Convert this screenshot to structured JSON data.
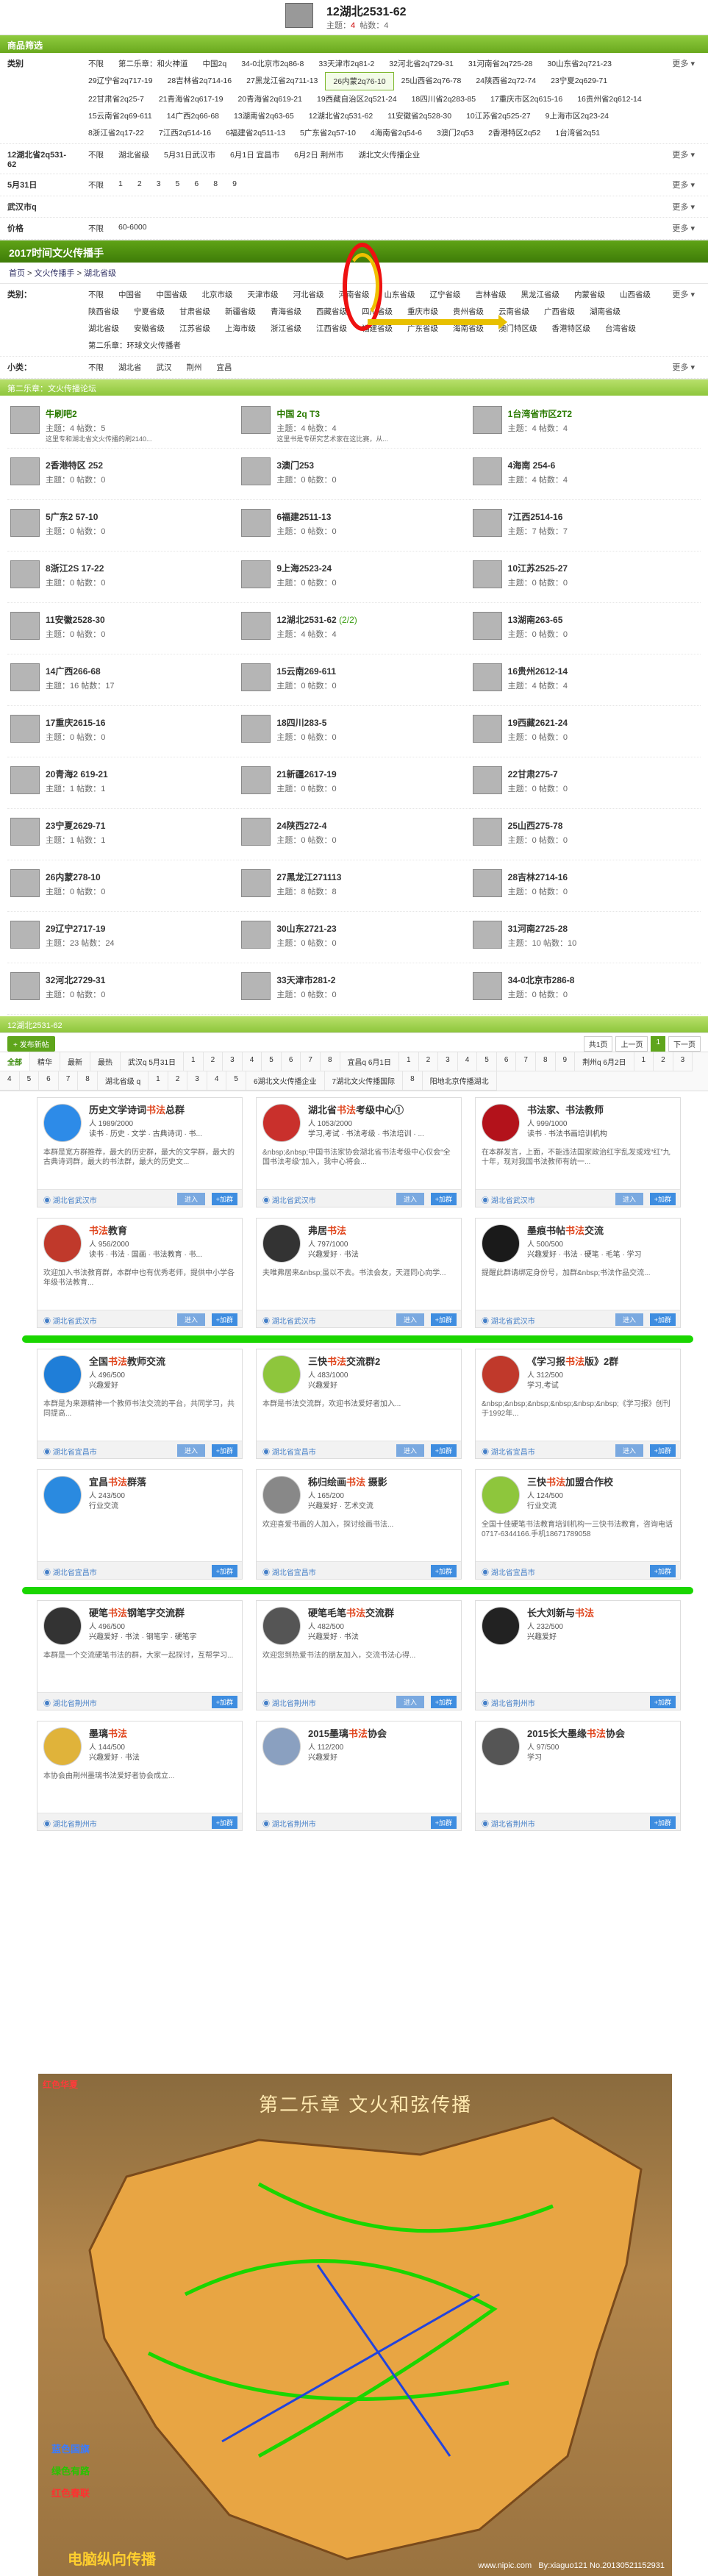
{
  "header": {
    "title": "12湖北2531-62",
    "topics_label": "主题：",
    "topics": "4",
    "posts_label": "帖数：",
    "posts": "4"
  },
  "filter_bar": "商品筛选",
  "filter_rows": [
    {
      "label": "类别",
      "options": [
        "不限",
        "第二乐章：和火神道",
        "中国2q",
        "34-0北京市2q86-8",
        "33天津市2q81-2",
        "32河北省2q729-31",
        "31河南省2q725-28",
        "30山东省2q721-23",
        "29辽宁省2q717-19",
        "28吉林省2q714-16",
        "27黑龙江省2q711-13",
        "26内蒙2q76-10",
        "25山西省2q76-78",
        "24陕西省2q72-74",
        "23宁夏2q629-71",
        "22甘肃省2q25-7",
        "21青海省2q617-19",
        "20青海省2q619-21",
        "19西藏自治区2q521-24",
        "18四川省2q283-85",
        "17重庆市区2q615-16",
        "16贵州省2q612-14",
        "15云南省2q69-611",
        "14广西2q66-68",
        "13湖南省2q63-65",
        "12湖北省2q531-62",
        "11安徽省2q528-30",
        "10江苏省2q525-27",
        "9上海市区2q23-24",
        "8浙江省2q17-22",
        "7江西2q514-16",
        "6福建省2q511-13",
        "5广东省2q57-10",
        "4海南省2q54-6",
        "3澳门2q53",
        "2香港特区2q52",
        "1台湾省2q51"
      ],
      "active": 11
    },
    {
      "label": "12湖北省2q531-62",
      "options": [
        "不限",
        "湖北省级",
        "5月31日武汉市",
        "6月1日 宜昌市",
        "6月2日 荆州市",
        "湖北文火传播企业"
      ]
    },
    {
      "label": "5月31日",
      "options": [
        "不限",
        "1",
        "2",
        "3",
        "5",
        "6",
        "8",
        "9"
      ]
    },
    {
      "label": "武汉市q",
      "options": []
    },
    {
      "label": "价格",
      "options": [
        "不限",
        "60-6000"
      ]
    }
  ],
  "more_label": "更多",
  "section_title": "2017时间文火传播手",
  "crumb": [
    "首页",
    "文火传播手",
    "湖北省级"
  ],
  "filter2": [
    {
      "label": "类别：",
      "options": [
        "不限",
        "中国省",
        "中国省级",
        "北京市级",
        "天津市级",
        "河北省级",
        "河南省级",
        "山东省级",
        "辽宁省级",
        "吉林省级",
        "黑龙江省级",
        "内蒙省级",
        "山西省级",
        "陕西省级",
        "宁夏省级",
        "甘肃省级",
        "新疆省级",
        "青海省级",
        "西藏省级",
        "四川省级",
        "重庆市级",
        "贵州省级",
        "云南省级",
        "广西省级",
        "湖南省级",
        "湖北省级",
        "安徽省级",
        "江苏省级",
        "上海市级",
        "浙江省级",
        "江西省级",
        "福建省级",
        "广东省级",
        "海南省级",
        "澳门特区级",
        "香港特区级",
        "台湾省级",
        "第二乐章：环球文火传播者"
      ]
    },
    {
      "label": "小类：",
      "options": [
        "不限",
        "湖北省",
        "武汉",
        "荆州",
        "宜昌"
      ]
    }
  ],
  "subbar": "第二乐章：文火传播论坛",
  "boards": [
    {
      "name": "牛刷吧2",
      "topics": "4",
      "posts": "5",
      "desc": "这里专和湖北省文火传播的刷2140..."
    },
    {
      "name": "中国 2q T3",
      "topics": "4",
      "posts": "4",
      "desc": "这里书是专研究艺术家在这比赛，从..."
    },
    {
      "name": "1台湾省市区2T2",
      "topics": "4",
      "posts": "4"
    },
    {
      "name": "2香港特区 252",
      "topics": "0",
      "posts": "0"
    },
    {
      "name": "3澳门253",
      "topics": "0",
      "posts": "0"
    },
    {
      "name": "4海南 254-6",
      "topics": "4",
      "posts": "4"
    },
    {
      "name": "5广东2 57-10",
      "topics": "0",
      "posts": "0"
    },
    {
      "name": "6福建2511-13",
      "topics": "0",
      "posts": "0"
    },
    {
      "name": "7江西2514-16",
      "topics": "7",
      "posts": "7"
    },
    {
      "name": "8浙江2S 17-22",
      "topics": "0",
      "posts": "0"
    },
    {
      "name": "9上海2523-24",
      "topics": "0",
      "posts": "0"
    },
    {
      "name": "10江苏2525-27",
      "topics": "0",
      "posts": "0"
    },
    {
      "name": "11安徽2528-30",
      "topics": "0",
      "posts": "0"
    },
    {
      "name": "12湖北2531-62",
      "extra": "(2/2)",
      "topics": "4",
      "posts": "4"
    },
    {
      "name": "13湖南263-65",
      "topics": "0",
      "posts": "0"
    },
    {
      "name": "14广西266-68",
      "topics": "16",
      "posts": "17"
    },
    {
      "name": "15云南269-611",
      "topics": "0",
      "posts": "0"
    },
    {
      "name": "16贵州2612-14",
      "topics": "4",
      "posts": "4"
    },
    {
      "name": "17重庆2615-16",
      "topics": "0",
      "posts": "0"
    },
    {
      "name": "18四川283-5",
      "topics": "0",
      "posts": "0"
    },
    {
      "name": "19西藏2621-24",
      "topics": "0",
      "posts": "0"
    },
    {
      "name": "20青海2 619-21",
      "topics": "1",
      "posts": "1"
    },
    {
      "name": "21新疆2617-19",
      "topics": "0",
      "posts": "0"
    },
    {
      "name": "22甘肃275-7",
      "topics": "0",
      "posts": "0"
    },
    {
      "name": "23宁夏2629-71",
      "topics": "1",
      "posts": "1"
    },
    {
      "name": "24陕西272-4",
      "topics": "0",
      "posts": "0"
    },
    {
      "name": "25山西275-78",
      "topics": "0",
      "posts": "0"
    },
    {
      "name": "26内蒙278-10",
      "topics": "0",
      "posts": "0"
    },
    {
      "name": "27黑龙江271113",
      "topics": "8",
      "posts": "8"
    },
    {
      "name": "28吉林2714-16",
      "topics": "0",
      "posts": "0"
    },
    {
      "name": "29辽宁2717-19",
      "topics": "23",
      "posts": "24"
    },
    {
      "name": "30山东2721-23",
      "topics": "0",
      "posts": "0"
    },
    {
      "name": "31河南2725-28",
      "topics": "10",
      "posts": "10"
    },
    {
      "name": "32河北2729-31",
      "topics": "0",
      "posts": "0"
    },
    {
      "name": "33天津市281-2",
      "topics": "0",
      "posts": "0"
    },
    {
      "name": "34-0北京市286-8",
      "topics": "0",
      "posts": "0"
    }
  ],
  "list_bar": "12湖北2531-62",
  "post_btn": "+ 发布新帖",
  "pager": [
    "共1页",
    "上一页",
    "1",
    "下一页"
  ],
  "tabs": [
    "全部",
    "精华",
    "最新",
    "最热",
    "武汉q 5月31日",
    "1",
    "2",
    "3",
    "4",
    "5",
    "6",
    "7",
    "8",
    "宜昌q 6月1日",
    "1",
    "2",
    "3",
    "4",
    "5",
    "6",
    "7",
    "8",
    "9",
    "荆州q 6月2日",
    "1",
    "2",
    "3",
    "4",
    "5",
    "6",
    "7",
    "8",
    "湖北省级 q",
    "1",
    "2",
    "3",
    "4",
    "5",
    "6湖北文火传播企业",
    "7湖北文火传播国际",
    "8",
    "阳地北京传播湖北"
  ],
  "groups1": [
    {
      "name": "历史文学诗词",
      "hl": "书法",
      "tail": "总群",
      "members": "1989/2000",
      "tags": "读书 · 历史 · 文学 · 古典诗词 · 书...",
      "desc": "本群是宽方群推荐，最大的历史群，最大的文学群，最大的古典诗词群，最大的书法群，最大的历史文...",
      "loc": "湖北省武汉市",
      "join": "进入",
      "add": "+加群",
      "av": "#2d8be8"
    },
    {
      "name": "湖北省",
      "hl": "书法",
      "tail": "考级中心①",
      "members": "1053/2000",
      "tags": "学习,考试 · 书法考级 · 书法培训 · ...",
      "desc": "&nbsp;&nbsp;中国书法家协会湖北省书法考级中心仅会“全国书法考级”加入，我中心将会...",
      "loc": "湖北省武汉市",
      "join": "进入",
      "add": "+加群",
      "av": "#c9302c"
    },
    {
      "name": "书法",
      "hl": "",
      "tail": "家、书法教师",
      "members": "999/1000",
      "tags": "读书 · 书法书画培训机构",
      "desc": "在本群发言，上面，不能违法国家政治红字乱发或戏“红”九十年，现对我国书法教师有统一...",
      "loc": "湖北省武汉市",
      "join": "进入",
      "add": "+加群",
      "av": "#b3121b"
    },
    {
      "name": "",
      "hl": "书法",
      "tail": "教育",
      "members": "956/2000",
      "tags": "读书 · 书法 · 国画 · 书法教育 · 书...",
      "desc": "欢迎加入书法教育群，本群中也有优秀老师，提供中小学各年级书法教育...",
      "loc": "湖北省武汉市",
      "join": "进入",
      "add": "+加群",
      "av": "#c0392b"
    },
    {
      "name": "弗居",
      "hl": "书法",
      "tail": "",
      "members": "797/1000",
      "tags": "兴趣爱好 · 书法",
      "desc": "夫唯弗居来&nbsp;虽以不去。书法会友，天涯同心向学...",
      "loc": "湖北省武汉市",
      "join": "进入",
      "add": "+加群",
      "av": "#333"
    },
    {
      "name": "墨痕书帖",
      "hl": "书法",
      "tail": "交流",
      "members": "500/500",
      "tags": "兴趣爱好 · 书法 · 硬笔 · 毛笔 · 学习",
      "desc": "提醒此群请绑定身份号，加群&nbsp;书法作品交流...",
      "loc": "湖北省武汉市",
      "join": "进入",
      "add": "+加群",
      "av": "#1a1a1a"
    }
  ],
  "groups2": [
    {
      "name": "全国",
      "hl": "书法",
      "tail": "教师交流",
      "members": "496/500",
      "tags": "兴趣爱好",
      "desc": "本群是为来源精神一个教师书法交流的平台，共同学习，共同提高...",
      "loc": "湖北省宜昌市",
      "join": "进入",
      "add": "+加群",
      "av": "#1f7ed8"
    },
    {
      "name": "三快",
      "hl": "书法",
      "tail": "交流群2",
      "members": "483/1000",
      "tags": "兴趣爱好",
      "desc": "本群是书法交流群，欢迎书法爱好者加入...",
      "loc": "湖北省宜昌市",
      "join": "进入",
      "add": "+加群",
      "av": "#8ec63c"
    },
    {
      "name": "《学习报",
      "hl": "书法",
      "tail": "版》2群",
      "members": "312/500",
      "tags": "学习,考试",
      "desc": "&nbsp;&nbsp;&nbsp;&nbsp;&nbsp;&nbsp;《学习报》创刊于1992年...",
      "loc": "湖北省宜昌市",
      "join": "进入",
      "add": "+加群",
      "av": "#c0392b"
    },
    {
      "name": "宜昌",
      "hl": "书法",
      "tail": "群落",
      "members": "243/500",
      "tags": "行业交流",
      "desc": "",
      "loc": "湖北省宜昌市",
      "join": "",
      "add": "+加群",
      "av": "#2a8ae0"
    },
    {
      "name": "秭归绘画",
      "hl": "书法",
      "tail": " 摄影",
      "members": "165/200",
      "tags": "兴趣爱好 · 艺术交流",
      "desc": "欢迎喜爱书画的人加入，探讨绘画书法...",
      "loc": "湖北省宜昌市",
      "join": "",
      "add": "+加群",
      "av": "#888"
    },
    {
      "name": "三快",
      "hl": "书法",
      "tail": "加盟合作校",
      "members": "124/500",
      "tags": "行业交流",
      "desc": "全国十佳硬笔书法教育培训机构一三快书法教育，咨询电话0717-6344166.手机18671789058",
      "loc": "湖北省宜昌市",
      "join": "",
      "add": "+加群",
      "av": "#8ec63c"
    }
  ],
  "groups3": [
    {
      "name": "硬笔",
      "hl": "书法",
      "tail": "钢笔字交流群",
      "members": "496/500",
      "tags": "兴趣爱好 · 书法 · 钢笔字 · 硬笔字",
      "desc": "本群是一个交流硬笔书法的群，大家一起探讨，互帮学习...",
      "loc": "湖北省荆州市",
      "join": "",
      "add": "+加群",
      "av": "#333"
    },
    {
      "name": "硬笔毛笔",
      "hl": "书法",
      "tail": "交流群",
      "members": "482/500",
      "tags": "兴趣爱好 · 书法",
      "desc": "欢迎您到热爱书法的朋友加入，交流书法心得...",
      "loc": "湖北省荆州市",
      "join": "进入",
      "add": "+加群",
      "av": "#555"
    },
    {
      "name": "长大刘新与",
      "hl": "书法",
      "tail": "",
      "members": "232/500",
      "tags": "兴趣爱好",
      "desc": "",
      "loc": "湖北省荆州市",
      "join": "",
      "add": "+加群",
      "av": "#222"
    },
    {
      "name": "墨璃",
      "hl": "书法",
      "tail": "",
      "members": "144/500",
      "tags": "兴趣爱好 · 书法",
      "desc": "本协会由荆州墨璃书法爱好者协会成立...",
      "loc": "湖北省荆州市",
      "join": "",
      "add": "+加群",
      "av": "#e0b33a"
    },
    {
      "name": "2015墨璃",
      "hl": "书法",
      "tail": "协会",
      "members": "112/200",
      "tags": "兴趣爱好",
      "desc": "",
      "loc": "湖北省荆州市",
      "join": "",
      "add": "+加群",
      "av": "#8aa0c0"
    },
    {
      "name": "2015长大墨缘",
      "hl": "书法",
      "tail": "协会",
      "members": "97/500",
      "tags": "学习",
      "desc": "",
      "loc": "湖北省荆州市",
      "join": "",
      "add": "+加群",
      "av": "#555"
    }
  ],
  "poster": {
    "title": "第二乐章  文火和弦传播",
    "banner": "红色华夏",
    "legend": [
      "蓝色国旗",
      "绿色有路",
      "红色春联"
    ],
    "watermark": "电脑纵向传播",
    "site": "www.nipic.com",
    "credit": "By:xiaguo121 No.20130521152931"
  }
}
